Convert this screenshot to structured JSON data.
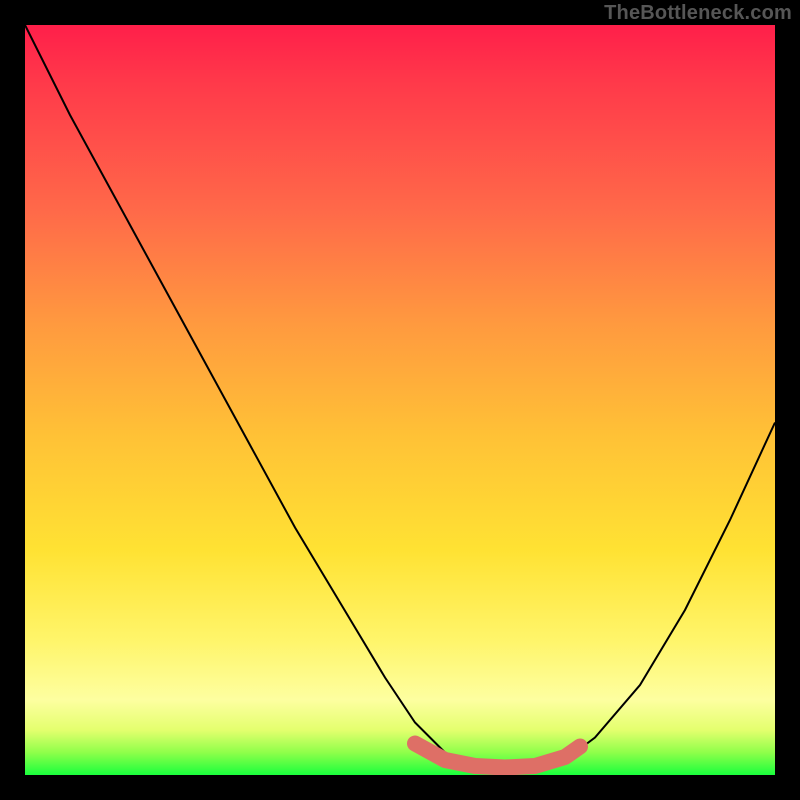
{
  "watermark": "TheBottleneck.com",
  "chart_data": {
    "type": "line",
    "title": "",
    "xlabel": "",
    "ylabel": "",
    "xlim": [
      0,
      100
    ],
    "ylim": [
      0,
      100
    ],
    "series": [
      {
        "name": "bottleneck-curve",
        "x": [
          0,
          6,
          12,
          18,
          24,
          30,
          36,
          42,
          48,
          52,
          56,
          60,
          64,
          68,
          72,
          76,
          82,
          88,
          94,
          100
        ],
        "y": [
          100,
          88,
          77,
          66,
          55,
          44,
          33,
          23,
          13,
          7,
          3,
          1,
          1,
          1,
          2,
          5,
          12,
          22,
          34,
          47
        ]
      }
    ],
    "highlight_band": {
      "name": "optimal-range",
      "x": [
        52,
        56,
        60,
        64,
        68,
        72,
        74
      ],
      "y": [
        4.2,
        2.0,
        1.2,
        1.0,
        1.2,
        2.4,
        3.8
      ],
      "color": "#de6f66"
    },
    "background_gradient": {
      "top": "#ff1f4a",
      "bottom": "#1aff3d"
    }
  }
}
